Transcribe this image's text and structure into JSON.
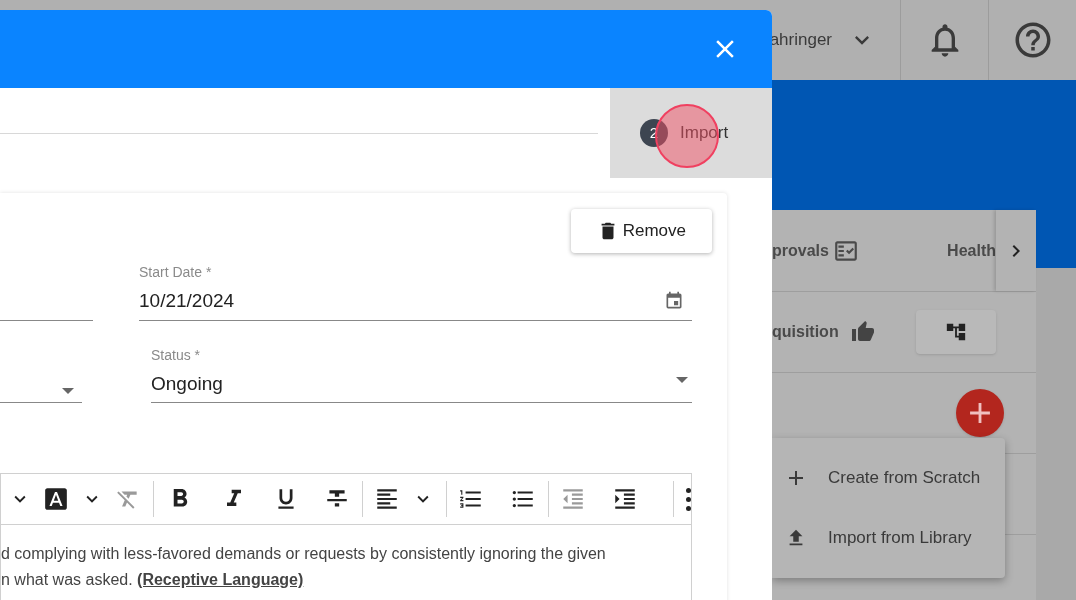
{
  "header": {
    "user_name": "ahringer"
  },
  "panel": {
    "tabs": [
      {
        "label": "provals"
      },
      {
        "label": "Health"
      }
    ],
    "row_label": "quisition"
  },
  "add_menu": {
    "items": [
      {
        "label": "Create from Scratch",
        "kind": "create"
      },
      {
        "label": "Import from Library",
        "kind": "upload"
      }
    ]
  },
  "dialog": {
    "stepper": {
      "steps": [
        {
          "number": "2",
          "label": "Import",
          "active": true
        }
      ]
    },
    "remove_button": "Remove",
    "start_date": {
      "label": "Start Date *",
      "value": "10/21/2024"
    },
    "status": {
      "label": "Status *",
      "value": "Ongoing"
    },
    "editor": {
      "lines": [
        "d complying with less-favored demands or requests by consistently ignoring the given",
        "n what was asked. **(Receptive Language)**"
      ]
    }
  }
}
